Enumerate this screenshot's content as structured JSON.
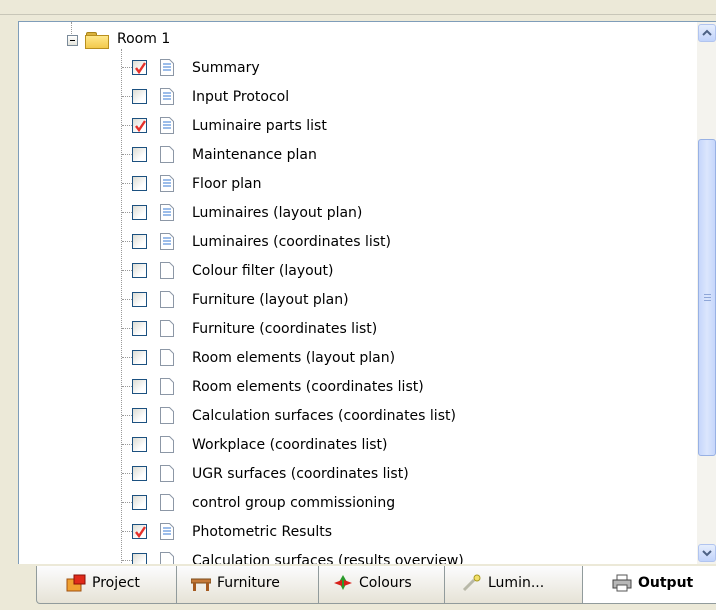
{
  "tree": {
    "room_label": "Room 1",
    "items": [
      {
        "label": "Summary",
        "checked": true,
        "icon": "document-lines-icon"
      },
      {
        "label": "Input Protocol",
        "checked": false,
        "icon": "document-lines-icon"
      },
      {
        "label": "Luminaire parts list",
        "checked": true,
        "icon": "document-lines-icon"
      },
      {
        "label": "Maintenance plan",
        "checked": false,
        "icon": "document-blank-icon"
      },
      {
        "label": "Floor plan",
        "checked": false,
        "icon": "document-lines-icon"
      },
      {
        "label": "Luminaires (layout plan)",
        "checked": false,
        "icon": "document-lines-icon"
      },
      {
        "label": "Luminaires (coordinates list)",
        "checked": false,
        "icon": "document-lines-icon"
      },
      {
        "label": "Colour filter (layout)",
        "checked": false,
        "icon": "document-blank-icon"
      },
      {
        "label": "Furniture (layout plan)",
        "checked": false,
        "icon": "document-blank-icon"
      },
      {
        "label": "Furniture (coordinates list)",
        "checked": false,
        "icon": "document-blank-icon"
      },
      {
        "label": "Room elements (layout plan)",
        "checked": false,
        "icon": "document-blank-icon"
      },
      {
        "label": "Room elements (coordinates list)",
        "checked": false,
        "icon": "document-blank-icon"
      },
      {
        "label": "Calculation surfaces (coordinates list)",
        "checked": false,
        "icon": "document-blank-icon"
      },
      {
        "label": "Workplace (coordinates list)",
        "checked": false,
        "icon": "document-blank-icon"
      },
      {
        "label": "UGR surfaces (coordinates list)",
        "checked": false,
        "icon": "document-blank-icon"
      },
      {
        "label": "control group commissioning",
        "checked": false,
        "icon": "document-blank-icon"
      },
      {
        "label": "Photometric Results",
        "checked": true,
        "icon": "document-lines-icon"
      },
      {
        "label": "Calculation surfaces (results overview)",
        "checked": false,
        "icon": "document-blank-icon"
      }
    ]
  },
  "tabs": [
    {
      "label": "Project",
      "icon": "project-icon",
      "active": false
    },
    {
      "label": "Furniture",
      "icon": "furniture-icon",
      "active": false
    },
    {
      "label": "Colours",
      "icon": "colours-icon",
      "active": false
    },
    {
      "label": "Lumin...",
      "icon": "luminaire-icon",
      "active": false
    },
    {
      "label": "Output",
      "icon": "printer-icon",
      "active": true
    }
  ],
  "colors": {
    "check": "#e5312b",
    "checkbox_border": "#1c5180",
    "doc_lines": "#3a7bd5",
    "scroll_thumb": "#c6d6fb"
  }
}
